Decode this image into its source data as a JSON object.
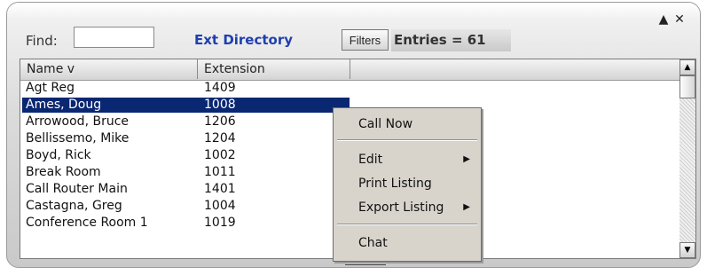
{
  "toolbar": {
    "find_label": "Find:",
    "find_value": "",
    "directory_title": "Ext Directory",
    "filters_label": "Filters",
    "entries_text": "Entries = 61"
  },
  "window_controls": {
    "pin_icon": "pin-icon",
    "close_icon": "close-icon"
  },
  "list": {
    "columns": [
      "Name  v",
      "Extension",
      ""
    ],
    "rows": [
      {
        "name": "Agt Reg",
        "ext": "1409"
      },
      {
        "name": "Ames, Doug",
        "ext": "1008"
      },
      {
        "name": "Arrowood, Bruce",
        "ext": "1206"
      },
      {
        "name": "Bellissemo, Mike",
        "ext": "1204"
      },
      {
        "name": "Boyd, Rick",
        "ext": "1002"
      },
      {
        "name": "Break Room",
        "ext": "1011"
      },
      {
        "name": "Call Router Main",
        "ext": "1401"
      },
      {
        "name": "Castagna, Greg",
        "ext": "1004"
      },
      {
        "name": "Conference Room 1",
        "ext": "1019"
      }
    ],
    "selected_index": 1
  },
  "context_menu": {
    "items": [
      {
        "label": "Call Now",
        "submenu": false
      },
      {
        "label": "Edit",
        "submenu": true
      },
      {
        "label": "Print Listing",
        "submenu": false
      },
      {
        "label": "Export Listing",
        "submenu": true
      },
      {
        "label": "Chat",
        "submenu": false
      }
    ]
  },
  "colors": {
    "title_blue": "#1f3fb0",
    "selection_navy": "#0a2772",
    "menu_bg": "#d8d4cc"
  }
}
